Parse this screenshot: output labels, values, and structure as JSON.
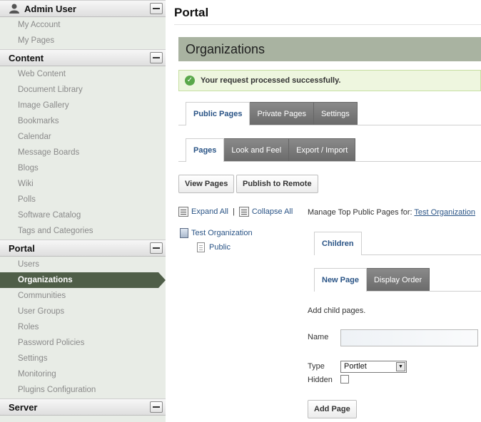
{
  "sidebar": {
    "sections": [
      {
        "title": "Admin User",
        "items": [
          "My Account",
          "My Pages"
        ]
      },
      {
        "title": "Content",
        "items": [
          "Web Content",
          "Document Library",
          "Image Gallery",
          "Bookmarks",
          "Calendar",
          "Message Boards",
          "Blogs",
          "Wiki",
          "Polls",
          "Software Catalog",
          "Tags and Categories"
        ]
      },
      {
        "title": "Portal",
        "items": [
          "Users",
          "Organizations",
          "Communities",
          "User Groups",
          "Roles",
          "Password Policies",
          "Settings",
          "Monitoring",
          "Plugins Configuration"
        ]
      },
      {
        "title": "Server",
        "items": []
      }
    ],
    "active_item": "Organizations"
  },
  "main": {
    "portal_title": "Portal",
    "org_title": "Organizations",
    "success_message": "Your request processed successfully.",
    "tabs_top": [
      "Public Pages",
      "Private Pages",
      "Settings"
    ],
    "tabs_second": [
      "Pages",
      "Look and Feel",
      "Export / Import"
    ],
    "buttons": {
      "view_pages": "View Pages",
      "publish_remote": "Publish to Remote",
      "add_page": "Add Page"
    },
    "tree": {
      "expand_all": "Expand All",
      "separator": "|",
      "collapse_all": "Collapse All",
      "org_name": "Test Organization",
      "public": "Public"
    },
    "manage": {
      "label": "Manage Top Public Pages for:",
      "link": "Test Organization"
    },
    "children_tab": "Children",
    "tabs_new": [
      "New Page",
      "Display Order"
    ],
    "form": {
      "add_child_label": "Add child pages.",
      "name_label": "Name",
      "name_value": "",
      "type_label": "Type",
      "type_value": "Portlet",
      "hidden_label": "Hidden"
    }
  },
  "colors": {
    "sidebar_bg": "#e8ece6",
    "active_bg": "#4f5e48",
    "org_bar_bg": "#a9b3a1",
    "link": "#2a5486",
    "success_bg": "#eef6df"
  }
}
